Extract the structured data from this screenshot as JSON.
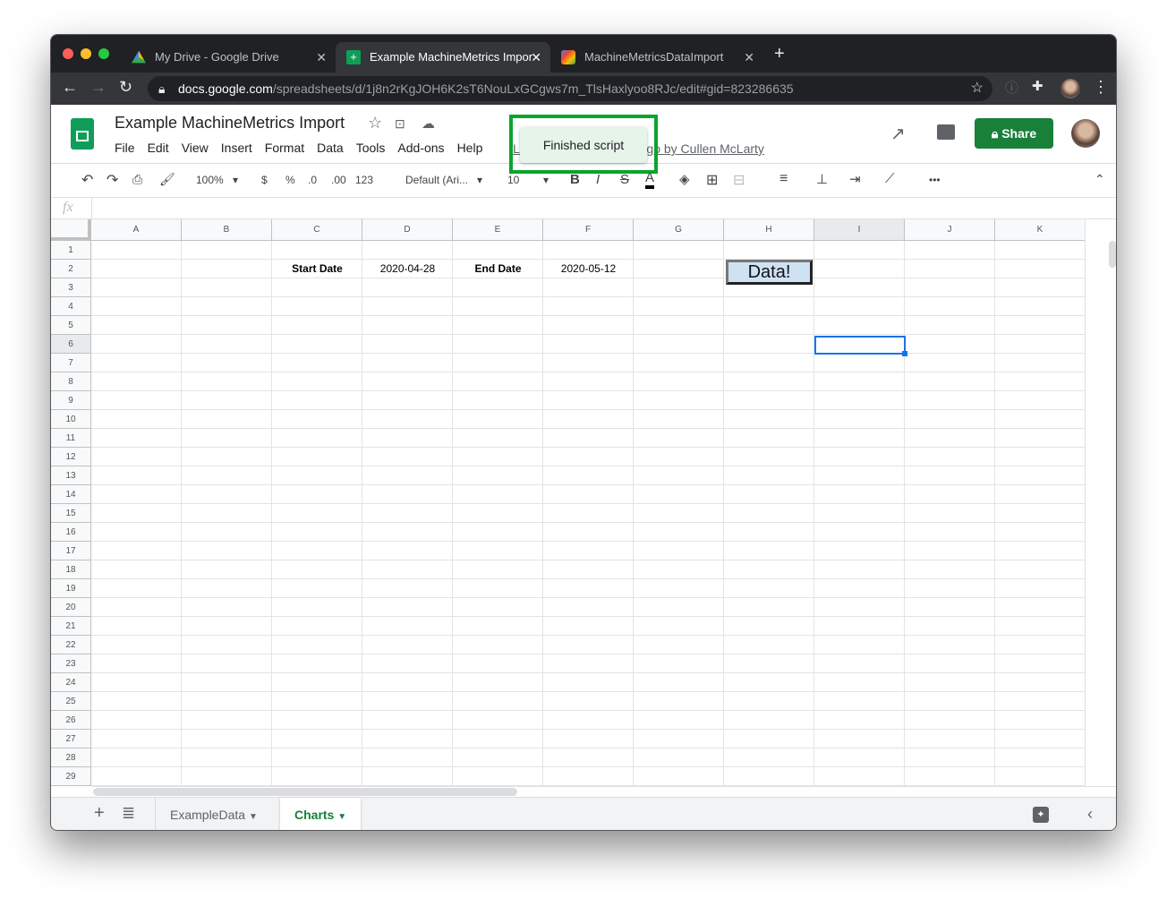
{
  "browser": {
    "tabs": [
      {
        "title": "My Drive - Google Drive",
        "icon": "google-drive-icon",
        "active": false
      },
      {
        "title": "Example MachineMetrics Impor",
        "icon": "google-sheets-icon",
        "active": true
      },
      {
        "title": "MachineMetricsDataImport",
        "icon": "apps-script-icon",
        "active": false
      }
    ],
    "url_host": "docs.google.com",
    "url_path": "/spreadsheets/d/1j8n2rKgJOH6K2sT6NouLxGCgws7m_TlsHaxlyoo8RJc/edit#gid=823286635"
  },
  "doc": {
    "title": "Example MachineMetrics Import",
    "menu": [
      "File",
      "Edit",
      "View",
      "Insert",
      "Format",
      "Data",
      "Tools",
      "Add-ons",
      "Help"
    ],
    "last_edit": "Last edit was seconds ago by Cullen McLarty",
    "toast": "Finished script",
    "share_label": "Share",
    "accent": "#188038",
    "highlight_color": "#0aa52b"
  },
  "toolbar": {
    "zoom": "100%",
    "currency": "$",
    "percent": "%",
    "dec_less": ".0",
    "dec_more": ".00",
    "format": "123",
    "font": "Default (Ari...",
    "size": "10",
    "bold": "B",
    "italic": "I",
    "strike": "S",
    "textcolor": "A",
    "more": "•••"
  },
  "formula": {
    "fx": "fx",
    "value": ""
  },
  "sheet": {
    "columns": [
      "A",
      "B",
      "C",
      "D",
      "E",
      "F",
      "G",
      "H",
      "I",
      "J",
      "K"
    ],
    "rows": 29,
    "selected": "I6",
    "cells": [
      {
        "ref": "C2",
        "col": 2,
        "row": 2,
        "value": "Start Date",
        "bold": true
      },
      {
        "ref": "D2",
        "col": 3,
        "row": 2,
        "value": "2020-04-28",
        "bold": false
      },
      {
        "ref": "E2",
        "col": 4,
        "row": 2,
        "value": "End Date",
        "bold": true
      },
      {
        "ref": "F2",
        "col": 5,
        "row": 2,
        "value": "2020-05-12",
        "bold": false
      }
    ],
    "button_label": "Data!"
  },
  "sheet_tabs": [
    {
      "name": "ExampleData",
      "active": false
    },
    {
      "name": "Charts",
      "active": true
    }
  ]
}
